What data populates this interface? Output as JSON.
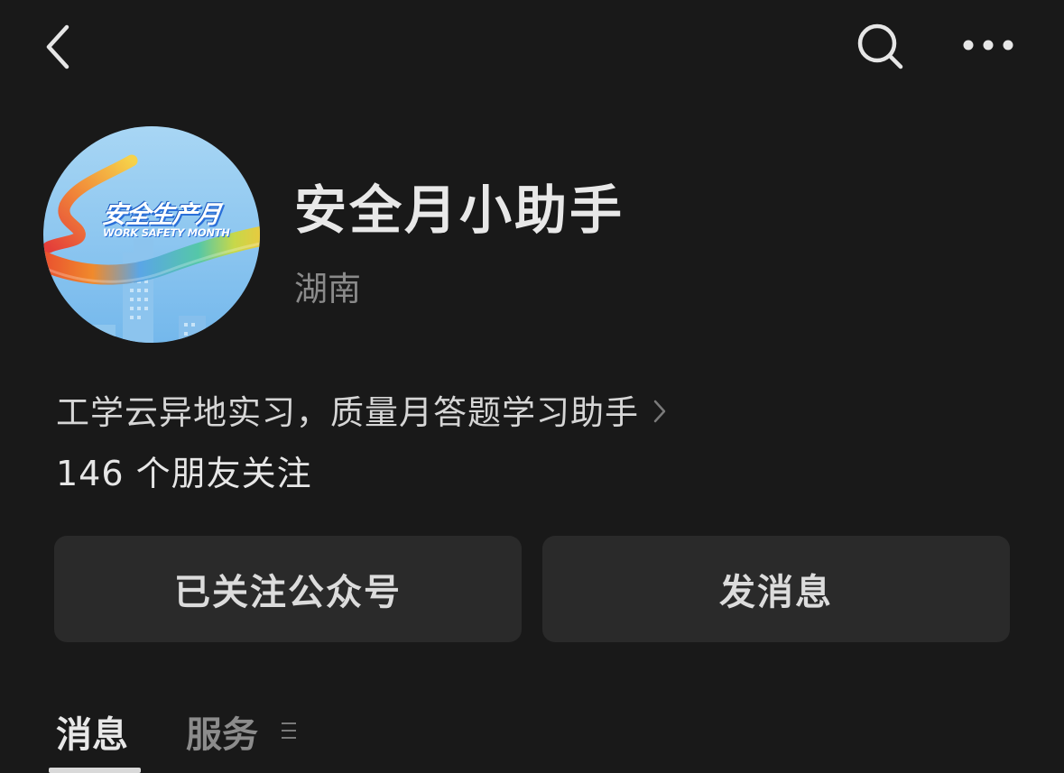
{
  "header": {
    "back_icon": "chevron-left-icon",
    "search_icon": "search-icon",
    "more_icon": "more-horizontal-icon"
  },
  "account": {
    "avatar_title": "安全生产月",
    "avatar_subtitle": "WORK SAFETY MONTH",
    "name": "安全月小助手",
    "region": "湖南",
    "description": "工学云异地实习，质量月答题学习助手",
    "followers": "146 个朋友关注"
  },
  "actions": {
    "followed_label": "已关注公众号",
    "message_label": "发消息"
  },
  "tabs": [
    {
      "label": "消息",
      "active": true
    },
    {
      "label": "服务",
      "active": false
    }
  ],
  "colors": {
    "background": "#191919",
    "button_bg": "#2a2a2a",
    "text_primary": "#e8e8e8",
    "text_secondary": "#8a8a8a"
  }
}
